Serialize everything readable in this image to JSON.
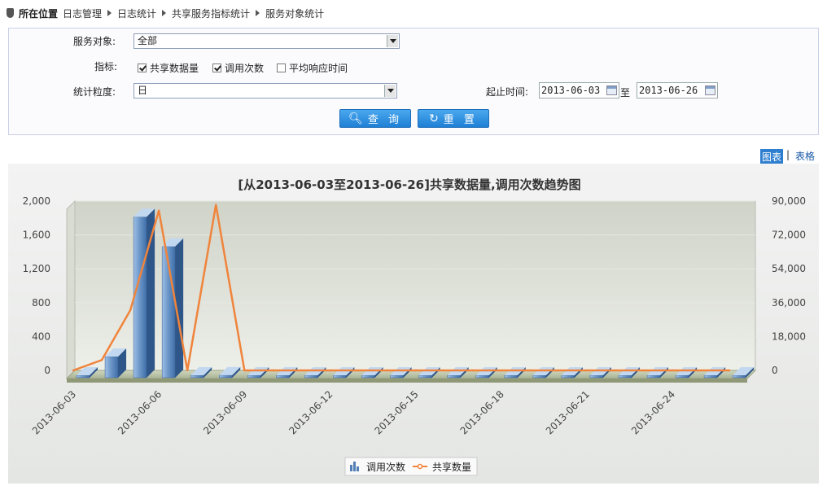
{
  "breadcrumb": {
    "lead": "所在位置",
    "items": [
      "日志管理",
      "日志统计",
      "共享服务指标统计",
      "服务对象统计"
    ]
  },
  "filter": {
    "service_label": "服务对象:",
    "service_value": "全部",
    "metric_label": "指标:",
    "metrics": [
      {
        "label": "共享数据量",
        "checked": true
      },
      {
        "label": "调用次数",
        "checked": true
      },
      {
        "label": "平均响应时间",
        "checked": false
      }
    ],
    "granularity_label": "统计粒度:",
    "granularity_value": "日",
    "time_label": "起止时间:",
    "start_date": "2013-06-03",
    "to_label": "至",
    "end_date": "2013-06-26",
    "query_label": "查 询",
    "reset_label": "重 置"
  },
  "view_toggle": {
    "chart": "图表",
    "sep": "|",
    "table": "表格"
  },
  "chart_data": {
    "type": "bar",
    "title": "[从2013-06-03至2013-06-26]共享数据量,调用次数趋势图",
    "categories": [
      "2013-06-03",
      "2013-06-04",
      "2013-06-05",
      "2013-06-06",
      "2013-06-07",
      "2013-06-08",
      "2013-06-09",
      "2013-06-10",
      "2013-06-11",
      "2013-06-12",
      "2013-06-13",
      "2013-06-14",
      "2013-06-15",
      "2013-06-16",
      "2013-06-17",
      "2013-06-18",
      "2013-06-19",
      "2013-06-20",
      "2013-06-21",
      "2013-06-22",
      "2013-06-23",
      "2013-06-24",
      "2013-06-25",
      "2013-06-26"
    ],
    "x_tick_labels": [
      "2013-06-03",
      "2013-06-06",
      "2013-06-09",
      "2013-06-12",
      "2013-06-15",
      "2013-06-18",
      "2013-06-21",
      "2013-06-24"
    ],
    "series": [
      {
        "name": "调用次数",
        "kind": "bar",
        "axis": "left",
        "color": "#4f7fb5",
        "values": [
          0,
          250,
          1900,
          1550,
          0,
          30,
          0,
          0,
          0,
          0,
          0,
          0,
          0,
          0,
          0,
          0,
          0,
          0,
          0,
          0,
          0,
          0,
          0,
          0
        ]
      },
      {
        "name": "共享数量",
        "kind": "line",
        "axis": "right",
        "color": "#f0843c",
        "values": [
          0,
          5500,
          32000,
          85000,
          0,
          88000,
          0,
          0,
          0,
          0,
          0,
          0,
          0,
          0,
          0,
          0,
          0,
          0,
          0,
          0,
          0,
          0,
          0,
          0
        ]
      }
    ],
    "y_left": {
      "ticks": [
        "0",
        "400",
        "800",
        "1,200",
        "1,600",
        "2,000"
      ],
      "range": [
        0,
        2000
      ]
    },
    "y_right": {
      "ticks": [
        "0",
        "18,000",
        "36,000",
        "54,000",
        "72,000",
        "90,000"
      ],
      "range": [
        0,
        90000
      ]
    },
    "grid": true,
    "legend_position": "bottom"
  }
}
